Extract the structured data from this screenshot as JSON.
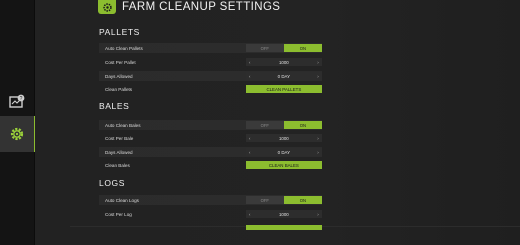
{
  "title": "FARM CLEANUP SETTINGS",
  "sidebar": {
    "items": [
      {
        "icon": "help-map-icon"
      },
      {
        "icon": "gear-icon",
        "active": true
      }
    ]
  },
  "sections": [
    {
      "title": "PALLETS",
      "rows": [
        {
          "label": "Auto Clean Pallets",
          "type": "toggle",
          "off": "OFF",
          "on": "ON",
          "value": "ON"
        },
        {
          "label": "Cost Per Pallet",
          "type": "stepper",
          "value": "1000"
        },
        {
          "label": "Days Allowed",
          "type": "stepper",
          "value": "0 DAY"
        },
        {
          "label": "Clean Pallets",
          "type": "button",
          "button": "CLEAN PALLETS"
        }
      ]
    },
    {
      "title": "BALES",
      "rows": [
        {
          "label": "Auto Clean Bales",
          "type": "toggle",
          "off": "OFF",
          "on": "ON",
          "value": "ON"
        },
        {
          "label": "Cost Per Bale",
          "type": "stepper",
          "value": "1000"
        },
        {
          "label": "Days Allowed",
          "type": "stepper",
          "value": "0 DAY"
        },
        {
          "label": "Clean Bales",
          "type": "button",
          "button": "CLEAN BALES"
        }
      ]
    },
    {
      "title": "LOGS",
      "rows": [
        {
          "label": "Auto Clean Logs",
          "type": "toggle",
          "off": "OFF",
          "on": "ON",
          "value": "ON"
        },
        {
          "label": "Cost Per Log",
          "type": "stepper",
          "value": "1000"
        }
      ]
    }
  ],
  "colors": {
    "accent": "#8cbd2f",
    "panel": "#232323",
    "sidebar": "#141414"
  }
}
